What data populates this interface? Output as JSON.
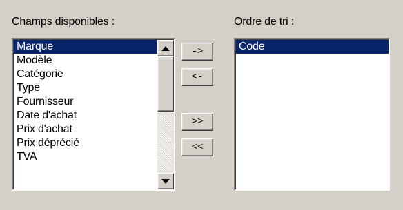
{
  "available": {
    "label": "Champs disponibles :",
    "items": [
      "Marque",
      "Modèle",
      "Catégorie",
      "Type",
      "Fournisseur",
      "Date d'achat",
      "Prix d'achat",
      "Prix déprécié",
      "TVA"
    ],
    "selected_index": 0
  },
  "order": {
    "label": "Ordre de tri :",
    "items": [
      "Code"
    ],
    "selected_index": 0
  },
  "buttons": {
    "add": "->",
    "remove": "<-",
    "add_all": ">>",
    "remove_all": "<<"
  }
}
